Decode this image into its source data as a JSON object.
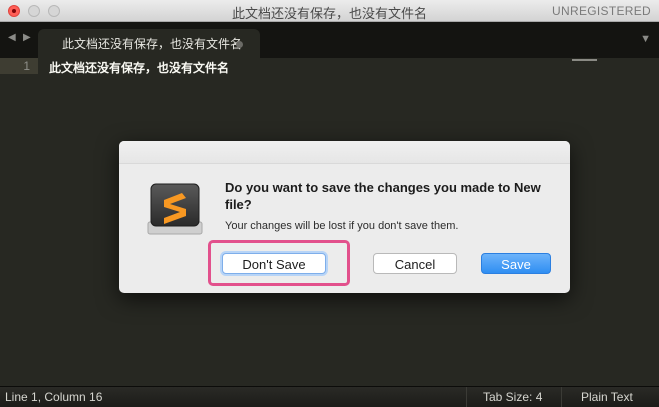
{
  "window": {
    "title": "此文档还没有保存，也没有文件名",
    "registration": "UNREGISTERED"
  },
  "tabs": {
    "nav_left": "◀",
    "nav_right": "▶",
    "menu": "▼",
    "active_tab_label": "此文档还没有保存，也没有文件名"
  },
  "editor": {
    "line_number": "1",
    "line_text": "此文档还没有保存，也没有文件名"
  },
  "dialog": {
    "heading": "Do you want to save the changes you made to New file?",
    "body": "Your changes will be lost if you don't save them.",
    "dont_save_label": "Don't Save",
    "cancel_label": "Cancel",
    "save_label": "Save",
    "icon": "sublime-text-icon"
  },
  "status_bar": {
    "position": "Line 1, Column 16",
    "tab_size": "Tab Size: 4",
    "syntax": "Plain Text"
  },
  "colors": {
    "editor_bg": "#272822",
    "highlight": "#e2508c",
    "save_button": "#2f8ef2",
    "app_icon_accent": "#f89822"
  }
}
